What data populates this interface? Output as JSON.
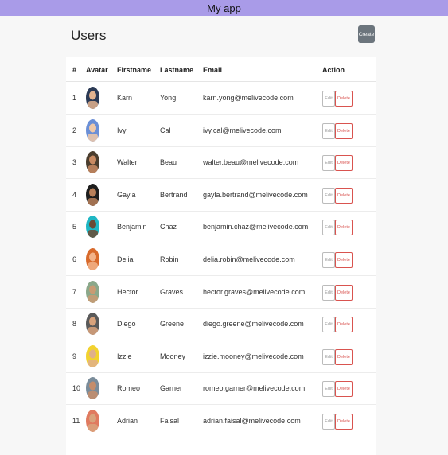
{
  "app": {
    "title": "My app"
  },
  "page": {
    "title": "Users",
    "create_label": "Create"
  },
  "table": {
    "headers": {
      "num": "#",
      "avatar": "Avatar",
      "firstname": "Firstname",
      "lastname": "Lastname",
      "email": "Email",
      "action": "Action"
    },
    "edit_label": "Edit",
    "delete_label": "Delete",
    "rows": [
      {
        "id": "1",
        "first": "Karn",
        "last": "Yong",
        "email": "karn.yong@melivecode.com"
      },
      {
        "id": "2",
        "first": "Ivy",
        "last": "Cal",
        "email": "ivy.cal@melivecode.com"
      },
      {
        "id": "3",
        "first": "Walter",
        "last": "Beau",
        "email": "walter.beau@melivecode.com"
      },
      {
        "id": "4",
        "first": "Gayla",
        "last": "Bertrand",
        "email": "gayla.bertrand@melivecode.com"
      },
      {
        "id": "5",
        "first": "Benjamin",
        "last": "Chaz",
        "email": "benjamin.chaz@melivecode.com"
      },
      {
        "id": "6",
        "first": "Delia",
        "last": "Robin",
        "email": "delia.robin@melivecode.com"
      },
      {
        "id": "7",
        "first": "Hector",
        "last": "Graves",
        "email": "hector.graves@melivecode.com"
      },
      {
        "id": "8",
        "first": "Diego",
        "last": "Greene",
        "email": "diego.greene@melivecode.com"
      },
      {
        "id": "9",
        "first": "Izzie",
        "last": "Mooney",
        "email": "izzie.mooney@melivecode.com"
      },
      {
        "id": "10",
        "first": "Romeo",
        "last": "Garner",
        "email": "romeo.garner@melivecode.com"
      },
      {
        "id": "11",
        "first": "Adrian",
        "last": "Faisal",
        "email": "adrian.faisal@melivecode.com"
      }
    ]
  },
  "colors": {
    "topbar": "#a99be8",
    "create_button": "#6c757d",
    "delete": "#d9534f"
  }
}
